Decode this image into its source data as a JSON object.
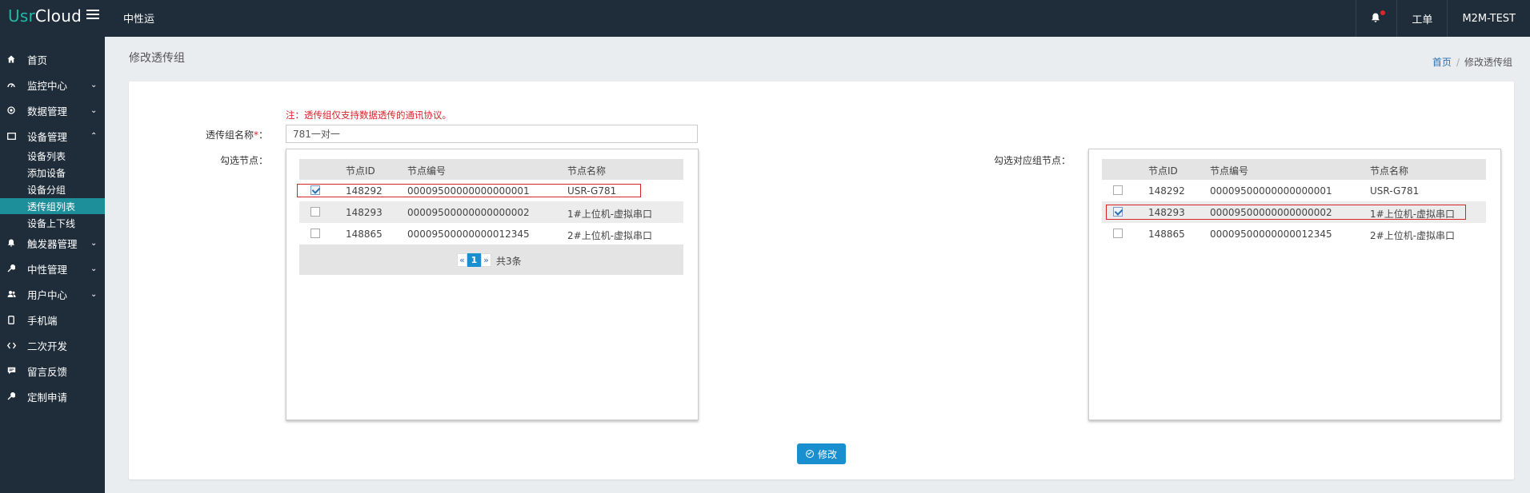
{
  "header": {
    "logo_part1": "Usr",
    "logo_part2": "Cloud",
    "title": "中性运",
    "work_order": "工单",
    "account": "M2M-TEST"
  },
  "sidebar": {
    "items": [
      {
        "label": "首页",
        "icon": "home-icon"
      },
      {
        "label": "监控中心",
        "icon": "dashboard-icon"
      },
      {
        "label": "数据管理",
        "icon": "database-icon"
      },
      {
        "label": "设备管理",
        "icon": "device-icon"
      },
      {
        "label": "触发器管理",
        "icon": "bell-icon"
      },
      {
        "label": "中性管理",
        "icon": "wrench-icon"
      },
      {
        "label": "用户中心",
        "icon": "users-icon"
      },
      {
        "label": "手机端",
        "icon": "mobile-icon"
      },
      {
        "label": "二次开发",
        "icon": "code-icon"
      },
      {
        "label": "留言反馈",
        "icon": "comment-icon"
      },
      {
        "label": "定制申请",
        "icon": "tools-icon"
      }
    ],
    "device_sub": [
      "设备列表",
      "添加设备",
      "设备分组",
      "透传组列表",
      "设备上下线"
    ]
  },
  "page": {
    "title": "修改透传组",
    "breadcrumb_home": "首页",
    "breadcrumb_current": "修改透传组"
  },
  "form": {
    "note": "注：透传组仅支持数据透传的通讯协议。",
    "name_label": "透传组名称",
    "required_mark": "*",
    "name_colon": "：",
    "name_value": "781一对一",
    "select_label": "勾选节点：",
    "target_label": "勾选对应组节点：",
    "submit_label": "修改"
  },
  "table": {
    "headers": [
      "节点ID",
      "节点编号",
      "节点名称"
    ]
  },
  "left_rows": [
    {
      "id": "148292",
      "code": "00009500000000000001",
      "name": "USR-G781",
      "checked": true
    },
    {
      "id": "148293",
      "code": "00009500000000000002",
      "name": "1#上位机-虚拟串口",
      "checked": false
    },
    {
      "id": "148865",
      "code": "00009500000000012345",
      "name": "2#上位机-虚拟串口",
      "checked": false
    }
  ],
  "right_rows": [
    {
      "id": "148292",
      "code": "00009500000000000001",
      "name": "USR-G781",
      "checked": false
    },
    {
      "id": "148293",
      "code": "00009500000000000002",
      "name": "1#上位机-虚拟串口",
      "checked": true
    },
    {
      "id": "148865",
      "code": "00009500000000012345",
      "name": "2#上位机-虚拟串口",
      "checked": false
    }
  ],
  "pager": {
    "prev": "«",
    "current": "1",
    "next": "»",
    "total": "共3条"
  }
}
